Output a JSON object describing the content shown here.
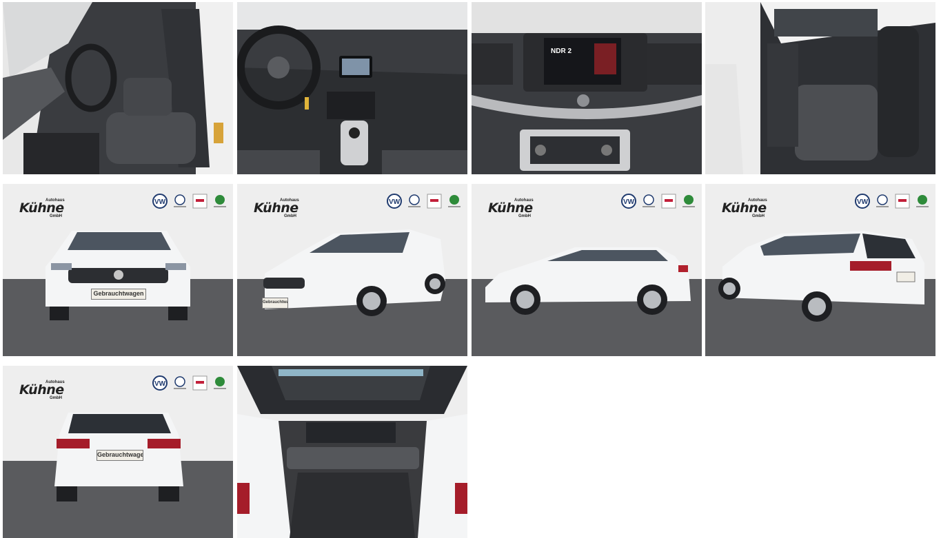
{
  "gallery": {
    "dealer": {
      "name": "Kühne",
      "label_top": "Autohaus",
      "label_bottom": "GmbH"
    },
    "brands": [
      "vw-logo",
      "vw-nutzfahrzeuge-logo",
      "audi-service-logo",
      "skoda-logo"
    ],
    "plate_text": "Gebrauchtwagen",
    "radio_station": "NDR 2",
    "images": [
      {
        "subject": "driver-seat-interior"
      },
      {
        "subject": "dashboard-cockpit"
      },
      {
        "subject": "center-console-infotainment"
      },
      {
        "subject": "rear-seats"
      },
      {
        "subject": "front-view"
      },
      {
        "subject": "front-three-quarter-view"
      },
      {
        "subject": "side-view"
      },
      {
        "subject": "rear-three-quarter-view"
      },
      {
        "subject": "rear-view"
      },
      {
        "subject": "trunk-cargo-area"
      }
    ]
  },
  "colors": {
    "car_white": "#f4f5f6",
    "floor": "#5a5b5e",
    "backdrop": "#eeeeee",
    "interior_dark": "#2b2d30"
  }
}
